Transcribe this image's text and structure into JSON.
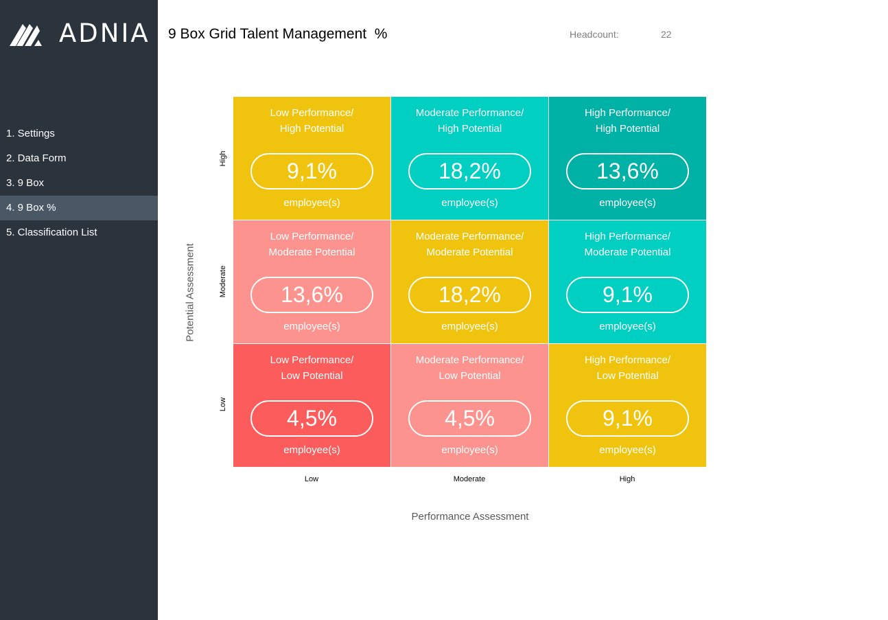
{
  "brand": {
    "name": "ADNIA",
    "logo_icon": "adnia-logo-icon"
  },
  "sidebar": {
    "items": [
      {
        "label": "1. Settings",
        "active": false
      },
      {
        "label": "2. Data Form",
        "active": false
      },
      {
        "label": "3. 9 Box",
        "active": false
      },
      {
        "label": "4. 9 Box %",
        "active": true
      },
      {
        "label": "5. Classification List",
        "active": false
      }
    ]
  },
  "header": {
    "title": "9 Box Grid Talent Management  %",
    "headcount_label": "Headcount:",
    "headcount_value": "22"
  },
  "grid": {
    "cells": [
      {
        "line1": "Low Performance/",
        "line2": "High Potential",
        "value": "9,1%",
        "sub": "employee(s)",
        "color": "#f0c40e"
      },
      {
        "line1": "Moderate Performance/",
        "line2": "High Potential",
        "value": "18,2%",
        "sub": "employee(s)",
        "color": "#00cfc1"
      },
      {
        "line1": "High Performance/",
        "line2": "High Potential",
        "value": "13,6%",
        "sub": "employee(s)",
        "color": "#00b1a5"
      },
      {
        "line1": "Low Performance/",
        "line2": "Moderate Potential",
        "value": "13,6%",
        "sub": "employee(s)",
        "color": "#fc938f"
      },
      {
        "line1": "Moderate Performance/",
        "line2": "Moderate Potential",
        "value": "18,2%",
        "sub": "employee(s)",
        "color": "#f0c40e"
      },
      {
        "line1": "High Performance/",
        "line2": "Moderate Potential",
        "value": "9,1%",
        "sub": "employee(s)",
        "color": "#00cfc1"
      },
      {
        "line1": "Low Performance/",
        "line2": "Low Potential",
        "value": "4,5%",
        "sub": "employee(s)",
        "color": "#fc5c5b"
      },
      {
        "line1": "Moderate Performance/",
        "line2": "Low Potential",
        "value": "4,5%",
        "sub": "employee(s)",
        "color": "#fc938f"
      },
      {
        "line1": "High Performance/",
        "line2": "Low Potential",
        "value": "9,1%",
        "sub": "employee(s)",
        "color": "#f0c40e"
      }
    ]
  },
  "axes": {
    "y_title": "Potential Assessment",
    "y_ticks": [
      "High",
      "Moderate",
      "Low"
    ],
    "x_title": "Performance Assessment",
    "x_ticks": [
      "Low",
      "Moderate",
      "High"
    ]
  }
}
